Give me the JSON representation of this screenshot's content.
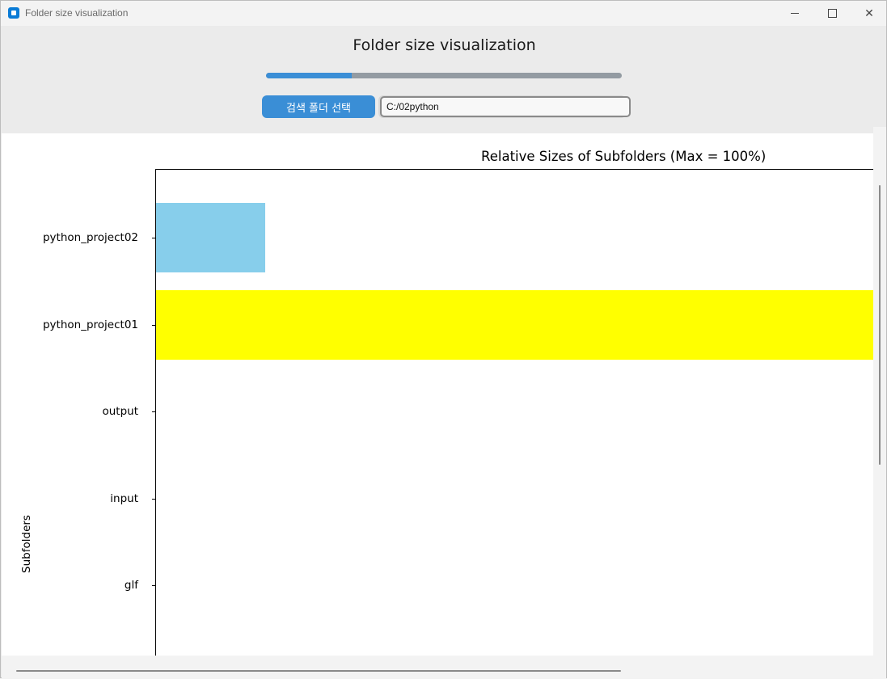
{
  "window": {
    "title": "Folder size visualization",
    "controls": {
      "minimize": "minimize-icon",
      "maximize": "maximize-icon",
      "close": "close-icon"
    }
  },
  "header": {
    "title": "Folder size visualization",
    "progress_fraction": 0.24,
    "select_button_label": "검색 폴더 선택",
    "path_value": "C:/02python"
  },
  "colors": {
    "accent": "#3a8ed6",
    "progress_track": "#939ba2"
  },
  "chart_data": {
    "type": "bar",
    "orientation": "horizontal",
    "title": "Relative Sizes of Subfolders (Max = 100%)",
    "ylabel": "Subfolders",
    "xlabel": "",
    "xlim": [
      0,
      100
    ],
    "categories": [
      "python_project02",
      "python_project01",
      "output",
      "input",
      "glf"
    ],
    "values": [
      15.2,
      100,
      0,
      0,
      0
    ],
    "bar_colors": [
      "#87ceeb",
      "#ffff00",
      "#87ceeb",
      "#87ceeb",
      "#87ceeb"
    ],
    "grid": false
  }
}
